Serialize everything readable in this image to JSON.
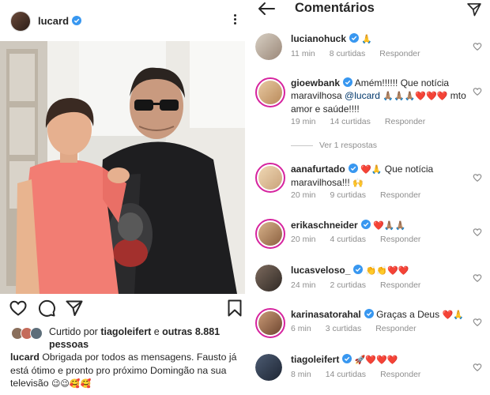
{
  "post": {
    "username": "lucard",
    "liked_by_prefix": "Curtido por",
    "liked_by_user": "tiagoleifert",
    "liked_by_and": "e",
    "liked_by_others": "outras 8.881 pessoas",
    "caption_user": "lucard",
    "caption_text": "Obrigada por todos as mensagens. Fausto já está ótimo e pronto pro próximo Domingão na sua televisão",
    "caption_emojis": "😉😉🥰🥰"
  },
  "comments_panel": {
    "title": "Comentários",
    "view_replies": "Ver 1 respostas",
    "items": [
      {
        "user": "lucianohuck",
        "verified": true,
        "text": "",
        "emojis": "🙏",
        "time": "11 min",
        "likes": "8 curtidas",
        "reply": "Responder"
      },
      {
        "user": "gioewbank",
        "verified": true,
        "text": "Amém!!!!!! Que notícia maravilhosa",
        "mention": "@lucard",
        "emojis_after_mention": "🙏🏽🙏🏽🙏🏽❤️❤️❤️",
        "text2": "mto amor e saúde!!!!",
        "time": "19 min",
        "likes": "14 curtidas",
        "reply": "Responder"
      },
      {
        "user": "aanafurtado",
        "verified": true,
        "text": "Que notícia maravilhosa!!!",
        "emojis_before": "❤️🙏",
        "emojis_after": "🙌",
        "time": "20 min",
        "likes": "9 curtidas",
        "reply": "Responder"
      },
      {
        "user": "erikaschneider",
        "verified": true,
        "text": "",
        "emojis": "❤️🙏🏽🙏🏽",
        "time": "20 min",
        "likes": "4 curtidas",
        "reply": "Responder"
      },
      {
        "user": "lucasveloso_",
        "verified": true,
        "text": "",
        "emojis": "👏👏❤️❤️",
        "time": "24 min",
        "likes": "2 curtidas",
        "reply": "Responder"
      },
      {
        "user": "karinasatorahal",
        "verified": true,
        "text": "Graças a Deus",
        "emojis": "❤️🙏",
        "time": "6 min",
        "likes": "3 curtidas",
        "reply": "Responder"
      },
      {
        "user": "tiagoleifert",
        "verified": true,
        "text": "",
        "emojis": "🚀❤️❤️❤️",
        "time": "8 min",
        "likes": "14 curtidas",
        "reply": "Responder"
      }
    ]
  },
  "colors": {
    "verified": "#3897f0",
    "meta": "#8e8e8e",
    "story_ring": "#d6249f",
    "mention": "#00376b"
  },
  "icons": [
    "kebab-icon",
    "heart-icon",
    "comment-icon",
    "share-icon",
    "bookmark-icon",
    "back-arrow-icon",
    "send-icon",
    "verified-icon"
  ]
}
